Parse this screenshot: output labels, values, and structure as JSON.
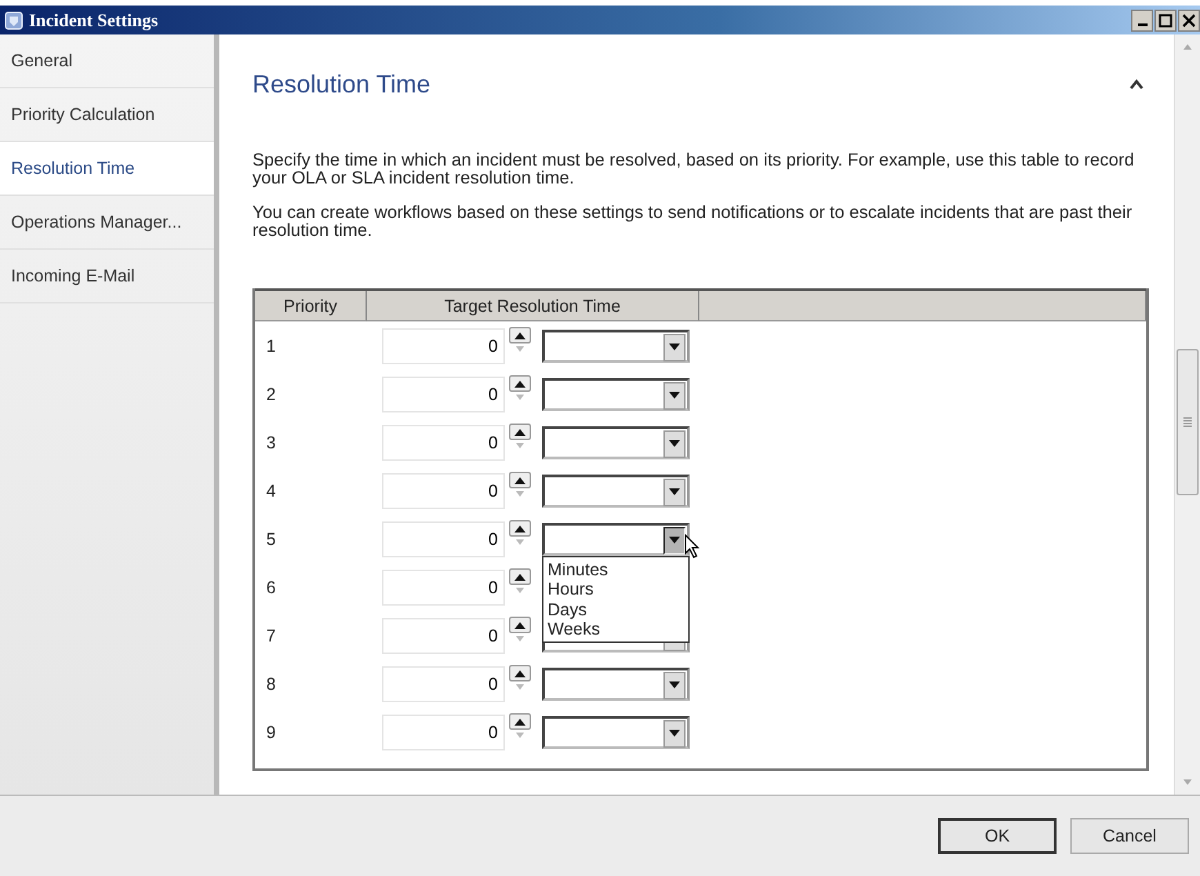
{
  "window": {
    "title": "Incident Settings"
  },
  "sidebar": {
    "items": [
      {
        "label": "General",
        "selected": false
      },
      {
        "label": "Priority Calculation",
        "selected": false
      },
      {
        "label": "Resolution Time",
        "selected": true
      },
      {
        "label": "Operations Manager...",
        "selected": false
      },
      {
        "label": "Incoming E-Mail",
        "selected": false
      }
    ]
  },
  "section": {
    "title": "Resolution Time",
    "expanded": true
  },
  "paragraphs": [
    "Specify the time in which an incident must be resolved, based on its priority. For example, use this table to record your OLA or SLA incident resolution time.",
    "You can create workflows based on these settings to send notifications or to escalate incidents that are past their resolution time."
  ],
  "table": {
    "columns": [
      "Priority",
      "Target Resolution Time"
    ],
    "rows": [
      {
        "priority": "1",
        "value": "0",
        "open": false
      },
      {
        "priority": "2",
        "value": "0",
        "open": false
      },
      {
        "priority": "3",
        "value": "0",
        "open": false
      },
      {
        "priority": "4",
        "value": "0",
        "open": false
      },
      {
        "priority": "5",
        "value": "0",
        "open": true,
        "options": [
          "Minutes",
          "Hours",
          "Days",
          "Weeks"
        ]
      },
      {
        "priority": "6",
        "value": "0",
        "covered": true
      },
      {
        "priority": "7",
        "value": "0",
        "open": false
      },
      {
        "priority": "8",
        "value": "0",
        "open": false
      },
      {
        "priority": "9",
        "value": "0",
        "open": false
      }
    ]
  },
  "buttons": [
    {
      "label": "OK",
      "default": true
    },
    {
      "label": "Cancel",
      "default": false
    }
  ]
}
